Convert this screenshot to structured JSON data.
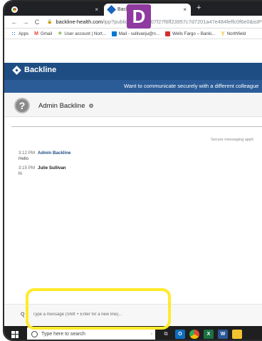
{
  "browser": {
    "tabs": [
      {
        "label": "",
        "close": "×"
      },
      {
        "label": "Backli",
        "close": "×"
      }
    ],
    "new_tab": "+",
    "nav": {
      "back": "←",
      "forward": "→",
      "reload": "C"
    },
    "url_host": "backline-health.com",
    "url_rest": "/ipp?publicToken=6507f27f6ff23957c7d7201a47e484feffc0f6e0&isIP",
    "bookmarks": [
      {
        "label": "Apps",
        "icon": "apps-grid-icon",
        "color": "#1a73e8"
      },
      {
        "label": "Gmail",
        "icon": "gmail-icon",
        "color": "#ea4335"
      },
      {
        "label": "User account | Nort...",
        "icon": "account-icon",
        "color": "#7cb342"
      },
      {
        "label": "Mail - sullivanju@n...",
        "icon": "outlook-icon",
        "color": "#0078d4"
      },
      {
        "label": "Wells Fargo – Banki...",
        "icon": "bank-icon",
        "color": "#d32f2f"
      },
      {
        "label": "Northfield",
        "icon": "northfield-icon",
        "color": "#fbc02d"
      }
    ]
  },
  "step_badge": "D",
  "app": {
    "brand": "Backline",
    "banner_text": "Want to communicate securely with a different colleague",
    "conversation_name": "Admin Backline",
    "avatar_glyph": "?",
    "secure_note": "Secure messaging appli",
    "messages": [
      {
        "time": "3:12 PM",
        "sender": "Admin Backline",
        "text": "Hello",
        "sender_color": "#1e4d84"
      },
      {
        "time": "3:15 PM",
        "sender": "Julie Sullivan",
        "text": "hi",
        "sender_color": "#222222"
      }
    ],
    "compose_placeholder": "Type a message (Shift + Enter for a new line)..."
  },
  "taskbar": {
    "search_placeholder": "Type here to search",
    "icons": [
      {
        "name": "microphone-icon",
        "glyph": "🎙",
        "color": "#1f1f1f"
      },
      {
        "name": "task-view-icon",
        "glyph": "⧉",
        "color": "#1f1f1f"
      },
      {
        "name": "outlook-app-icon",
        "glyph": "O",
        "color": "#0f6cbd"
      },
      {
        "name": "chrome-app-icon",
        "glyph": "◉",
        "color": "#f4b400"
      },
      {
        "name": "excel-app-icon",
        "glyph": "X",
        "color": "#1d7044"
      },
      {
        "name": "word-app-icon",
        "glyph": "W",
        "color": "#2b5797"
      },
      {
        "name": "file-explorer-icon",
        "glyph": "▭",
        "color": "#f4c430"
      }
    ]
  },
  "colors": {
    "brand_dark": "#1e4d84",
    "brand_mid": "#2b5c98",
    "highlight": "#ffeb2a",
    "badge": "#8e3a9e"
  }
}
